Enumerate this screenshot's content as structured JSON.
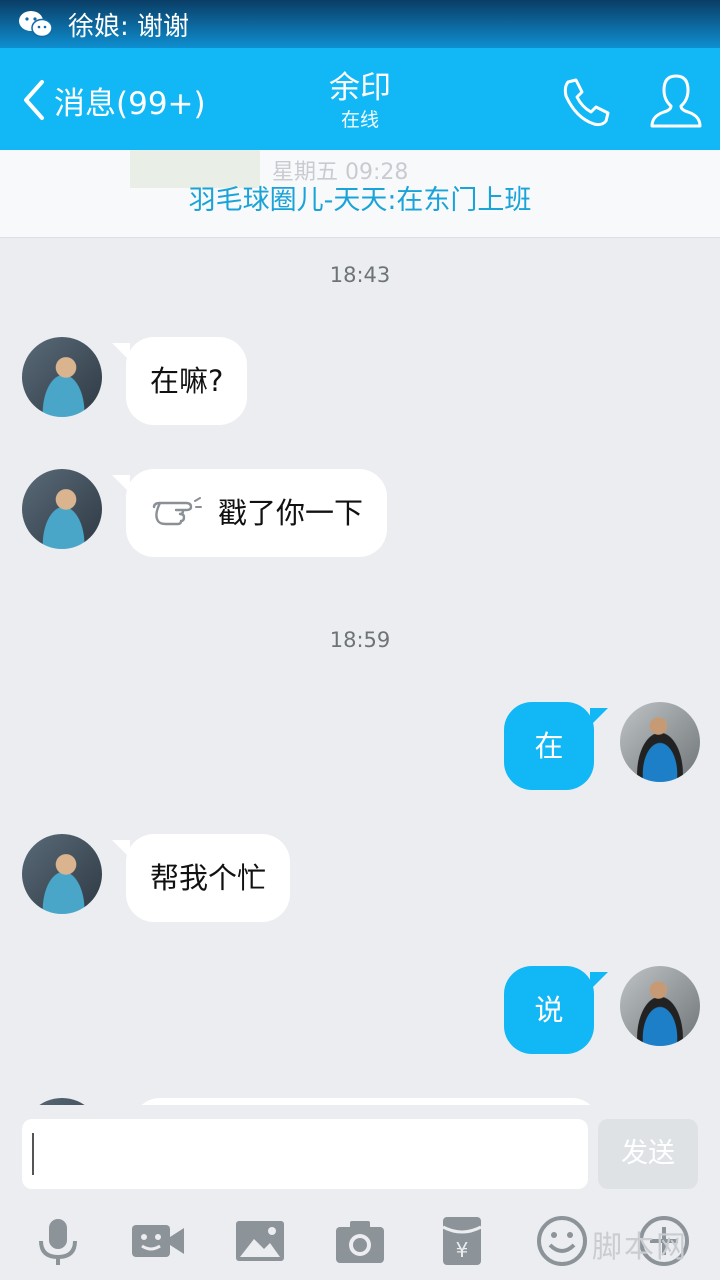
{
  "status": {
    "notification": "徐娘: 谢谢",
    "icon": "wechat-icon"
  },
  "header": {
    "back_label": "消息(99+)",
    "title": "余印",
    "subtitle": "在线",
    "color": "#12b7f5"
  },
  "banner": {
    "ghost_text": "星期五 09:28",
    "group_text": "羽毛球圈儿-天天:在东门上班"
  },
  "messages": {
    "ts1": "18:43",
    "m1": "在嘛?",
    "m2": "戳了你一下",
    "ts2": "18:59",
    "m3": "在",
    "m4": "帮我个忙",
    "m5": "说"
  },
  "input": {
    "value": "",
    "send_label": "发送"
  },
  "toolbar": [
    "mic-icon",
    "video-icon",
    "image-icon",
    "camera-icon",
    "red-packet-icon",
    "emoji-icon",
    "plus-icon"
  ],
  "watermark": "脚本网"
}
